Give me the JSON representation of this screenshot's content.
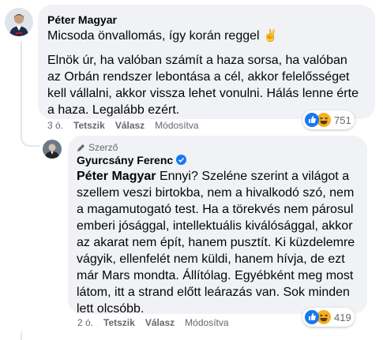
{
  "comment1": {
    "author": "Péter Magyar",
    "line1": "Micsoda önvallomás, így korán reggel",
    "emoji": "✌️",
    "paragraph": "Elnök úr, ha valóban számít a haza sorsa, ha valóban az Orbán rendszer lebontása a cél, akkor felelősséget kell vállalni, akkor vissza lehet vonulni. Hálás lenne érte a haza. Legalább ezért.",
    "time": "3 ó.",
    "like": "Tetszik",
    "reply": "Válasz",
    "edited": "Módosítva",
    "reaction_count": "751"
  },
  "comment2": {
    "author_tag": "Szerző",
    "author": "Gyurcsány Ferenc",
    "mention": "Péter Magyar",
    "text": "Ennyi? Szeléne szerint a világot a szellem veszi birtokba, nem a hivalkodó szó, nem a magamutogató test. Ha a törekvés nem párosul emberi jósággal, intellektuális kiválósággal, akkor az akarat nem épít, hanem pusztít. Ki küzdelemre vágyik, ellenfelét nem küldi, hanem hívja, de ezt már Mars mondta. Állítólag. Egyébként meg most látom, itt a strand előtt leárazás van. Sok minden lett olcsóbb.",
    "time": "2 ó.",
    "like": "Tetszik",
    "reply": "Válasz",
    "edited": "Módosítva",
    "reaction_count": "419"
  },
  "colors": {
    "bubble": "#f0f2f5",
    "meta": "#65676b",
    "like": "#1877f2",
    "haha": "#f7b125"
  }
}
